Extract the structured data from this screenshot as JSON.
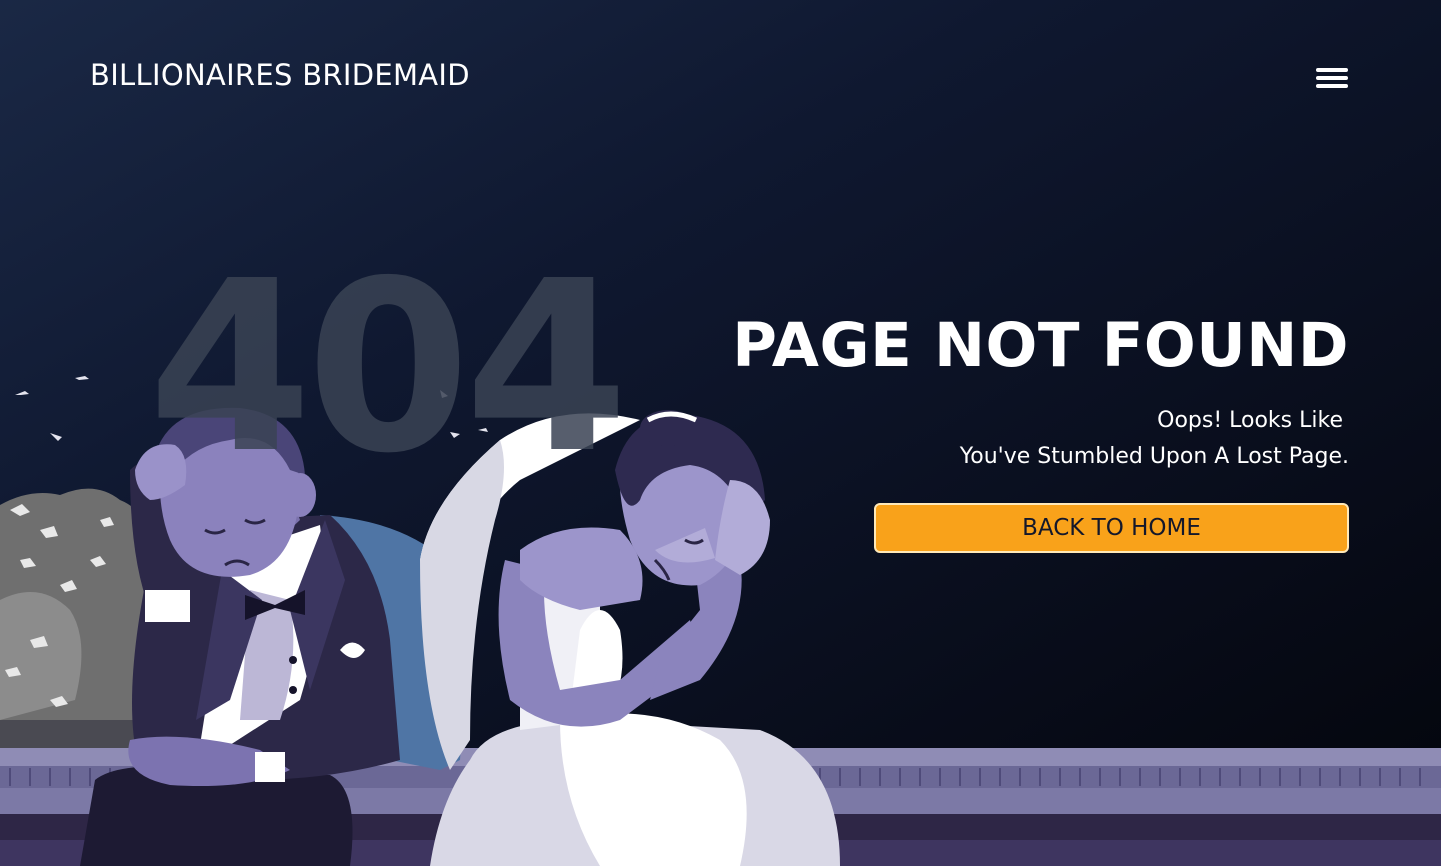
{
  "header": {
    "brand": "BILLIONAIRES BRIDEMAID",
    "menu_icon": "hamburger-menu-icon"
  },
  "hero": {
    "code": "404",
    "title": "PAGE NOT FOUND",
    "subtitle_line1": "Oops! Looks Like",
    "subtitle_line2": "You've Stumbled Upon A Lost Page.",
    "button_label": "BACK TO HOME"
  },
  "colors": {
    "accent": "#f9a21a",
    "background": "#0f1830",
    "text": "#ffffff",
    "button_text": "#14182b"
  },
  "illustration": {
    "subject": "sad-groom-and-bride-illustration"
  }
}
